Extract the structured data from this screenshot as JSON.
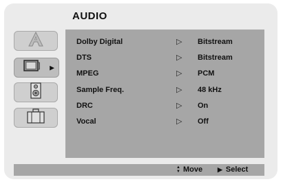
{
  "menu": {
    "title": "AUDIO"
  },
  "tabs": [
    {
      "name": "language",
      "icon": "letter-a-icon",
      "selected": false
    },
    {
      "name": "display",
      "icon": "monitor-icon",
      "selected": true,
      "arrow": "▶"
    },
    {
      "name": "audio",
      "icon": "speaker-icon",
      "selected": false
    },
    {
      "name": "others",
      "icon": "briefcase-icon",
      "selected": false
    }
  ],
  "settings": [
    {
      "label": "Dolby Digital",
      "arrow": "▷",
      "value": "Bitstream"
    },
    {
      "label": "DTS",
      "arrow": "▷",
      "value": "Bitstream"
    },
    {
      "label": "MPEG",
      "arrow": "▷",
      "value": "PCM"
    },
    {
      "label": "Sample Freq.",
      "arrow": "▷",
      "value": "48 kHz"
    },
    {
      "label": "DRC",
      "arrow": "▷",
      "value": "On"
    },
    {
      "label": "Vocal",
      "arrow": "▷",
      "value": "Off"
    }
  ],
  "footer": {
    "move_symbol": "▲▼",
    "move_label": "Move",
    "select_symbol": "▶",
    "select_label": "Select"
  }
}
